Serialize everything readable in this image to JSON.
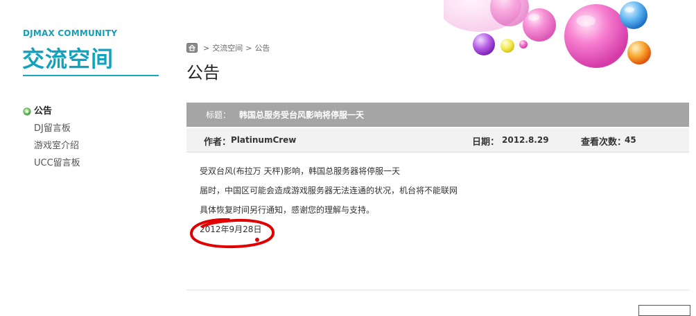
{
  "brand": {
    "small": "DJMAX COMMUNITY",
    "big": "交流空间"
  },
  "sidebar": {
    "items": [
      {
        "label": "公告"
      },
      {
        "label": "DJ留言板"
      },
      {
        "label": "游戏室介绍"
      },
      {
        "label": "UCC留言板"
      }
    ]
  },
  "breadcrumb": {
    "sep1": ">",
    "item1": "交流空间",
    "sep2": ">",
    "item2": "公告"
  },
  "page_title": "公告",
  "post": {
    "title_label": "标题：",
    "title": "韩国总服务受台风影响将停服一天",
    "author_label": "作者：",
    "author": "PlatinumCrew",
    "date_label": "日期：",
    "date": "2012.8.29",
    "views_label": "查看次数：",
    "views": "45",
    "body": [
      "受双台风(布拉万 天枰)影响，韩国总服务器将停服一天",
      "届时，中国区可能会造成游戏服务器无法连通的状况，机台将不能联网",
      "具体恢复时间另行通知，感谢您的理解与支持。",
      "2012年9月28日"
    ]
  },
  "colors": {
    "accent": "#11a2bd",
    "title_bar": "#a5a5a5",
    "meta_bar": "#f2f2f2",
    "annotation_red": "#e00000"
  },
  "icons": {
    "home": "home-icon",
    "bullet": "green-bullet-icon"
  }
}
